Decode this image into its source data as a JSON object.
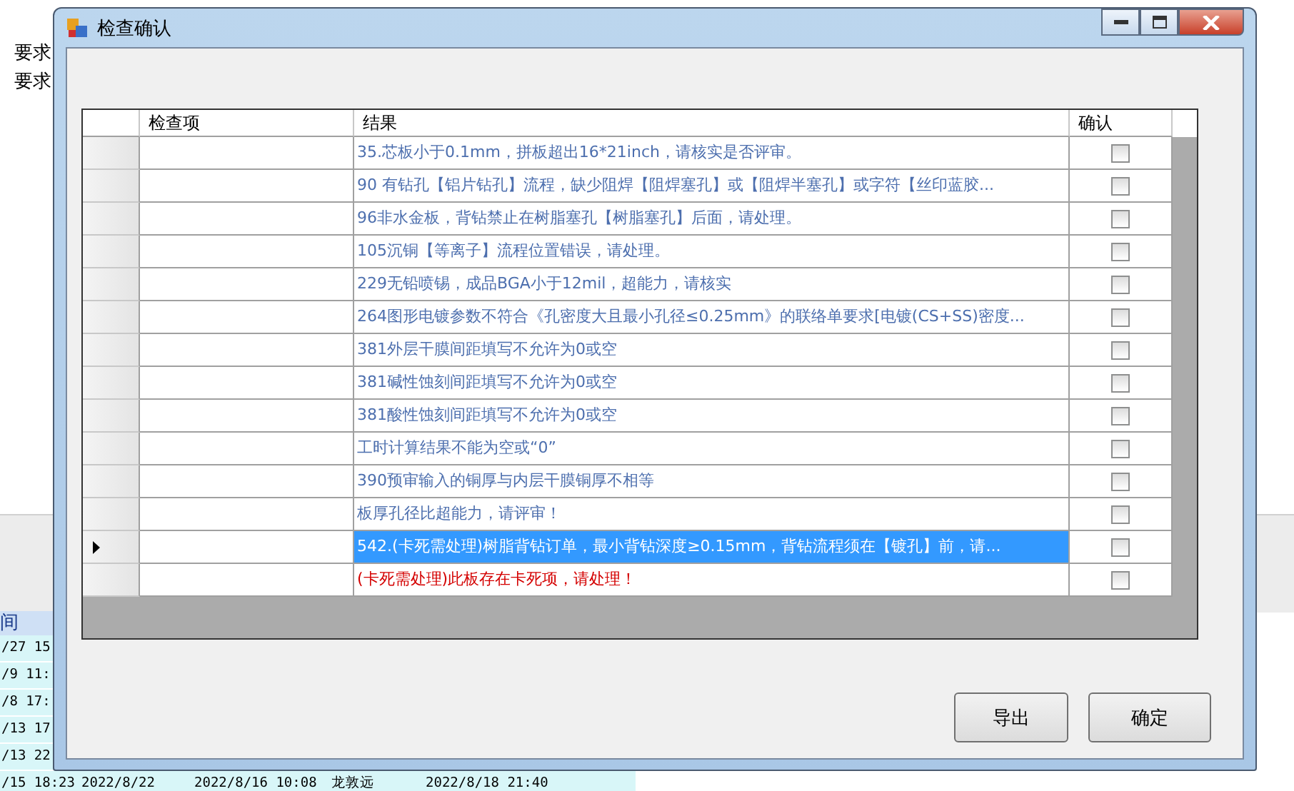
{
  "background": {
    "left_labels": [
      "要求",
      "要求"
    ],
    "column_header": "间",
    "rows": [
      [
        "/27 15"
      ],
      [
        "/9 11:"
      ],
      [
        "/8 17:"
      ],
      [
        "/13 17"
      ],
      [
        "/13 22"
      ],
      [
        "/15 18:23",
        "2022/8/22",
        "2022/8/16 10:08",
        "龙敦远",
        "2022/8/18 21:40"
      ]
    ]
  },
  "window": {
    "title": "检查确认"
  },
  "table": {
    "columns": [
      "检查项",
      "结果",
      "确认"
    ],
    "rows": [
      {
        "item": "",
        "result": "35.芯板小于0.1mm，拼板超出16*21inch，请核实是否评审。",
        "kind": "normal",
        "checked": false,
        "selected": false,
        "current": false
      },
      {
        "item": "",
        "result": "90 有钻孔【铝片钻孔】流程，缺少阻焊【阻焊塞孔】或【阻焊半塞孔】或字符【丝印蓝胶...",
        "kind": "normal",
        "checked": false,
        "selected": false,
        "current": false
      },
      {
        "item": "",
        "result": "96非水金板，背钻禁止在树脂塞孔【树脂塞孔】后面，请处理。",
        "kind": "normal",
        "checked": false,
        "selected": false,
        "current": false
      },
      {
        "item": "",
        "result": "105沉铜【等离子】流程位置错误，请处理。",
        "kind": "normal",
        "checked": false,
        "selected": false,
        "current": false
      },
      {
        "item": "",
        "result": "229无铅喷锡，成品BGA小于12mil，超能力，请核实",
        "kind": "normal",
        "checked": false,
        "selected": false,
        "current": false
      },
      {
        "item": "",
        "result": "264图形电镀参数不符合《孔密度大且最小孔径≤0.25mm》的联络单要求[电镀(CS+SS)密度...",
        "kind": "normal",
        "checked": false,
        "selected": false,
        "current": false
      },
      {
        "item": "",
        "result": "381外层干膜间距填写不允许为0或空",
        "kind": "normal",
        "checked": false,
        "selected": false,
        "current": false
      },
      {
        "item": "",
        "result": "381碱性蚀刻间距填写不允许为0或空",
        "kind": "normal",
        "checked": false,
        "selected": false,
        "current": false
      },
      {
        "item": "",
        "result": "381酸性蚀刻间距填写不允许为0或空",
        "kind": "normal",
        "checked": false,
        "selected": false,
        "current": false
      },
      {
        "item": "",
        "result": "工时计算结果不能为空或“0”",
        "kind": "normal",
        "checked": false,
        "selected": false,
        "current": false
      },
      {
        "item": "",
        "result": "390预审输入的铜厚与内层干膜铜厚不相等",
        "kind": "normal",
        "checked": false,
        "selected": false,
        "current": false
      },
      {
        "item": "",
        "result": "板厚孔径比超能力，请评审！",
        "kind": "normal",
        "checked": false,
        "selected": false,
        "current": false
      },
      {
        "item": "",
        "result": "542.(卡死需处理)树脂背钻订单，最小背钻深度≥0.15mm，背钻流程须在【镀孔】前，请...",
        "kind": "normal",
        "checked": false,
        "selected": true,
        "current": true
      },
      {
        "item": "",
        "result": "(卡死需处理)此板存在卡死项，请处理！",
        "kind": "blocking",
        "checked": false,
        "selected": false,
        "current": false
      }
    ]
  },
  "buttons": [
    "导出",
    "确定"
  ]
}
